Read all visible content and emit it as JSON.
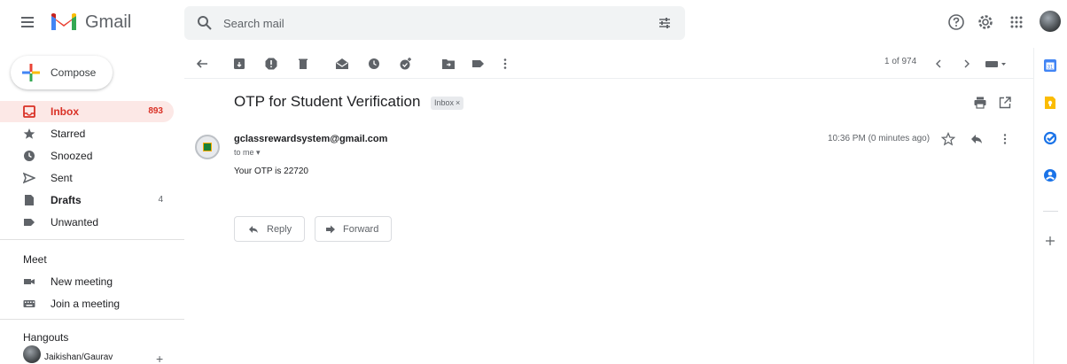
{
  "app": {
    "name": "Gmail",
    "brand_colors": {
      "red": "#d93025",
      "blue": "#4285f4",
      "green": "#34a853",
      "yellow": "#fbbc04"
    }
  },
  "header": {
    "search_placeholder": "Search mail",
    "icons": [
      "hamburger-icon",
      "search-icon",
      "tune-icon",
      "help-icon",
      "gear-icon",
      "apps-icon"
    ]
  },
  "sidebar": {
    "compose_label": "Compose",
    "items": [
      {
        "label": "Inbox",
        "count": "893",
        "icon": "inbox-icon",
        "active": true
      },
      {
        "label": "Starred",
        "count": "",
        "icon": "star-icon"
      },
      {
        "label": "Snoozed",
        "count": "",
        "icon": "clock-icon"
      },
      {
        "label": "Sent",
        "count": "",
        "icon": "send-icon"
      },
      {
        "label": "Drafts",
        "count": "4",
        "icon": "draft-icon"
      },
      {
        "label": "Unwanted",
        "count": "",
        "icon": "label-icon"
      }
    ],
    "meet": {
      "title": "Meet",
      "items": [
        {
          "label": "New meeting",
          "icon": "video-icon"
        },
        {
          "label": "Join a meeting",
          "icon": "keyboard-icon"
        }
      ]
    },
    "hangouts": {
      "title": "Hangouts",
      "contact": "Jaikishan/Gaurav"
    }
  },
  "toolbar": {
    "page_counter": "1 of 974",
    "icons": [
      "back-arrow-icon",
      "archive-icon",
      "report-spam-icon",
      "delete-icon",
      "mark-unread-icon",
      "snooze-icon",
      "add-task-icon",
      "move-to-icon",
      "labels-icon",
      "more-vert-icon",
      "newer-icon",
      "older-icon",
      "input-tools-icon"
    ]
  },
  "message": {
    "subject": "OTP for Student Verification",
    "label_chip": "Inbox",
    "label_chip_close": "×",
    "sender": "gclassrewardsystem@gmail.com",
    "to_line": "to me ▾",
    "timestamp": "10:36 PM (0 minutes ago)",
    "body": "Your OTP is 22720"
  },
  "actions": {
    "reply_label": "Reply",
    "forward_label": "Forward"
  },
  "side_panel": {
    "icons": [
      "calendar-icon",
      "keep-icon",
      "tasks-icon",
      "contacts-icon",
      "add-addon-icon"
    ]
  }
}
